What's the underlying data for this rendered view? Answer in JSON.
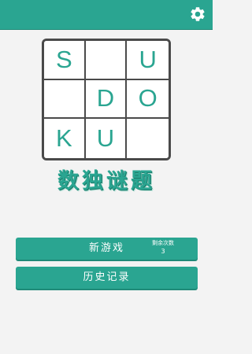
{
  "header": {
    "settings_icon": "gear-icon",
    "background_color": "#2aa591"
  },
  "grid": {
    "cells": [
      "S",
      "",
      "U",
      "",
      "D",
      "O",
      "K",
      "U",
      ""
    ],
    "letter_color": "#2aa591"
  },
  "title": "数独谜题",
  "buttons": {
    "new_game": {
      "label": "新游戏",
      "remaining_label": "剩余次数",
      "remaining_count": "3"
    },
    "history": {
      "label": "历史记录"
    }
  },
  "colors": {
    "accent": "#2aa591",
    "background": "#f3f3f3",
    "grid_border": "#4a4a4a"
  }
}
